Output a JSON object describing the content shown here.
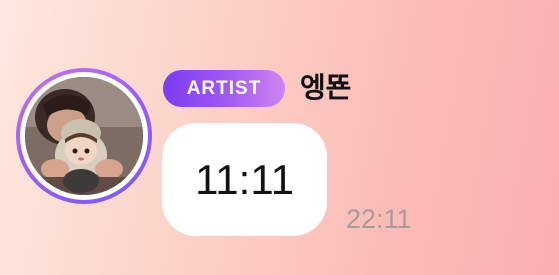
{
  "message": {
    "badge": "ARTIST",
    "sender_name": "엥뚄",
    "text": "11:11",
    "time": "22:11"
  },
  "colors": {
    "background_start": "#fde8df",
    "background_end": "#fbaeb3",
    "badge_start": "#7a3cf3",
    "badge_end": "#cf86ef",
    "avatar_ring": "#9b5df5",
    "bubble": "#ffffff",
    "time_text": "#a99a9a"
  }
}
